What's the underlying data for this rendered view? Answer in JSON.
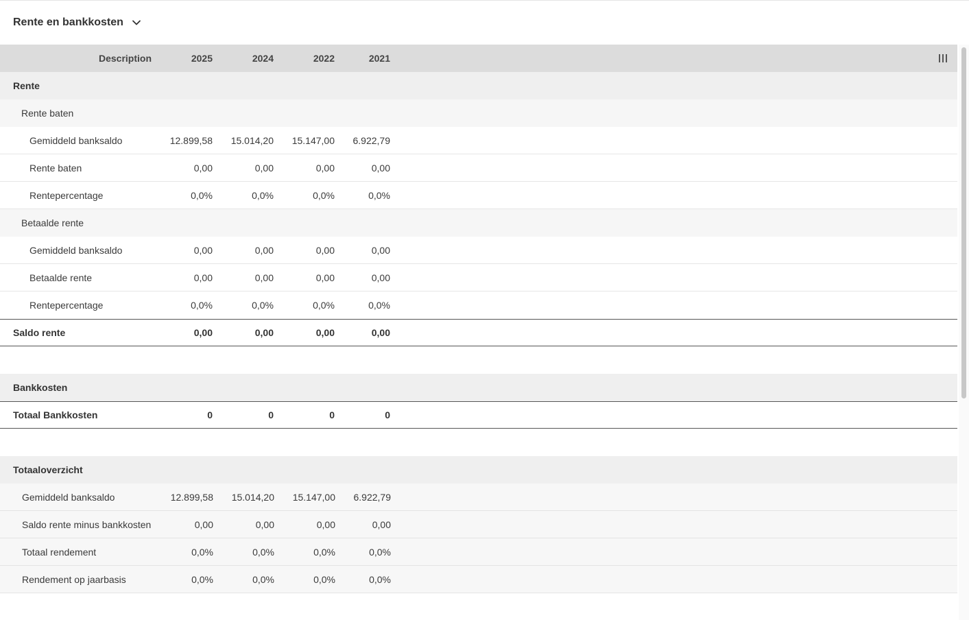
{
  "header": {
    "title": "Rente en bankkosten"
  },
  "table": {
    "columns": [
      "Description",
      "2025",
      "2024",
      "2022",
      "2021"
    ],
    "rente": {
      "label": "Rente",
      "baten": {
        "label": "Rente baten",
        "rows": [
          {
            "label": "Gemiddeld banksaldo",
            "values": [
              "12.899,58",
              "15.014,20",
              "15.147,00",
              "6.922,79"
            ]
          },
          {
            "label": "Rente baten",
            "values": [
              "0,00",
              "0,00",
              "0,00",
              "0,00"
            ]
          },
          {
            "label": "Rentepercentage",
            "values": [
              "0,0%",
              "0,0%",
              "0,0%",
              "0,0%"
            ]
          }
        ]
      },
      "betaald": {
        "label": "Betaalde rente",
        "rows": [
          {
            "label": "Gemiddeld banksaldo",
            "values": [
              "0,00",
              "0,00",
              "0,00",
              "0,00"
            ]
          },
          {
            "label": "Betaalde rente",
            "values": [
              "0,00",
              "0,00",
              "0,00",
              "0,00"
            ]
          },
          {
            "label": "Rentepercentage",
            "values": [
              "0,0%",
              "0,0%",
              "0,0%",
              "0,0%"
            ]
          }
        ]
      },
      "saldo": {
        "label": "Saldo rente",
        "values": [
          "0,00",
          "0,00",
          "0,00",
          "0,00"
        ]
      }
    },
    "bankkosten": {
      "label": "Bankkosten",
      "totaal": {
        "label": "Totaal Bankkosten",
        "values": [
          "0",
          "0",
          "0",
          "0"
        ]
      }
    },
    "overzicht": {
      "label": "Totaaloverzicht",
      "rows": [
        {
          "label": "Gemiddeld banksaldo",
          "values": [
            "12.899,58",
            "15.014,20",
            "15.147,00",
            "6.922,79"
          ]
        },
        {
          "label": "Saldo rente minus bankkosten",
          "values": [
            "0,00",
            "0,00",
            "0,00",
            "0,00"
          ]
        },
        {
          "label": "Totaal rendement",
          "values": [
            "0,0%",
            "0,0%",
            "0,0%",
            "0,0%"
          ]
        },
        {
          "label": "Rendement op jaarbasis",
          "values": [
            "0,0%",
            "0,0%",
            "0,0%",
            "0,0%"
          ]
        }
      ]
    }
  },
  "icons": {
    "header_toggle": "chevron-down-icon",
    "columns": "columns-icon"
  }
}
